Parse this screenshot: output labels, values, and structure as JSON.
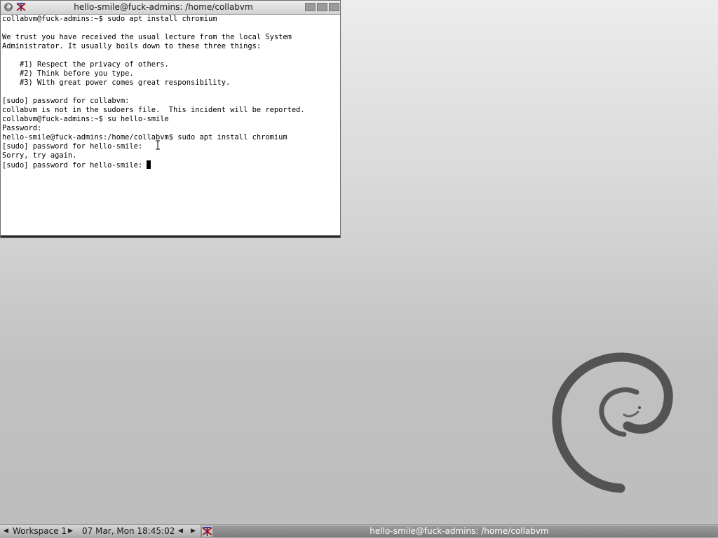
{
  "window": {
    "title": "hello-smile@fuck-admins: /home/collabvm",
    "icons": [
      "debian-menu-icon",
      "xterm-icon"
    ],
    "buttons": [
      "minimize",
      "maximize",
      "close"
    ]
  },
  "terminal": {
    "lines": [
      "collabvm@fuck-admins:~$ sudo apt install chromium",
      "",
      "We trust you have received the usual lecture from the local System",
      "Administrator. It usually boils down to these three things:",
      "",
      "    #1) Respect the privacy of others.",
      "    #2) Think before you type.",
      "    #3) With great power comes great responsibility.",
      "",
      "[sudo] password for collabvm:",
      "collabvm is not in the sudoers file.  This incident will be reported.",
      "collabvm@fuck-admins:~$ su hello-smile",
      "Password:",
      "hello-smile@fuck-admins:/home/collabvm$ sudo apt install chromium",
      "[sudo] password for hello-smile:",
      "Sorry, try again.",
      "[sudo] password for hello-smile: "
    ]
  },
  "taskbar": {
    "workspace": "Workspace 1",
    "clock": "07 Mar, Mon 18:45:02",
    "task_title": "hello-smile@fuck-admins: /home/collabvm"
  },
  "colors": {
    "desktop": "#c4c4c4",
    "swirl": "#4a4a4a",
    "xterm_icon": "#c01818"
  }
}
